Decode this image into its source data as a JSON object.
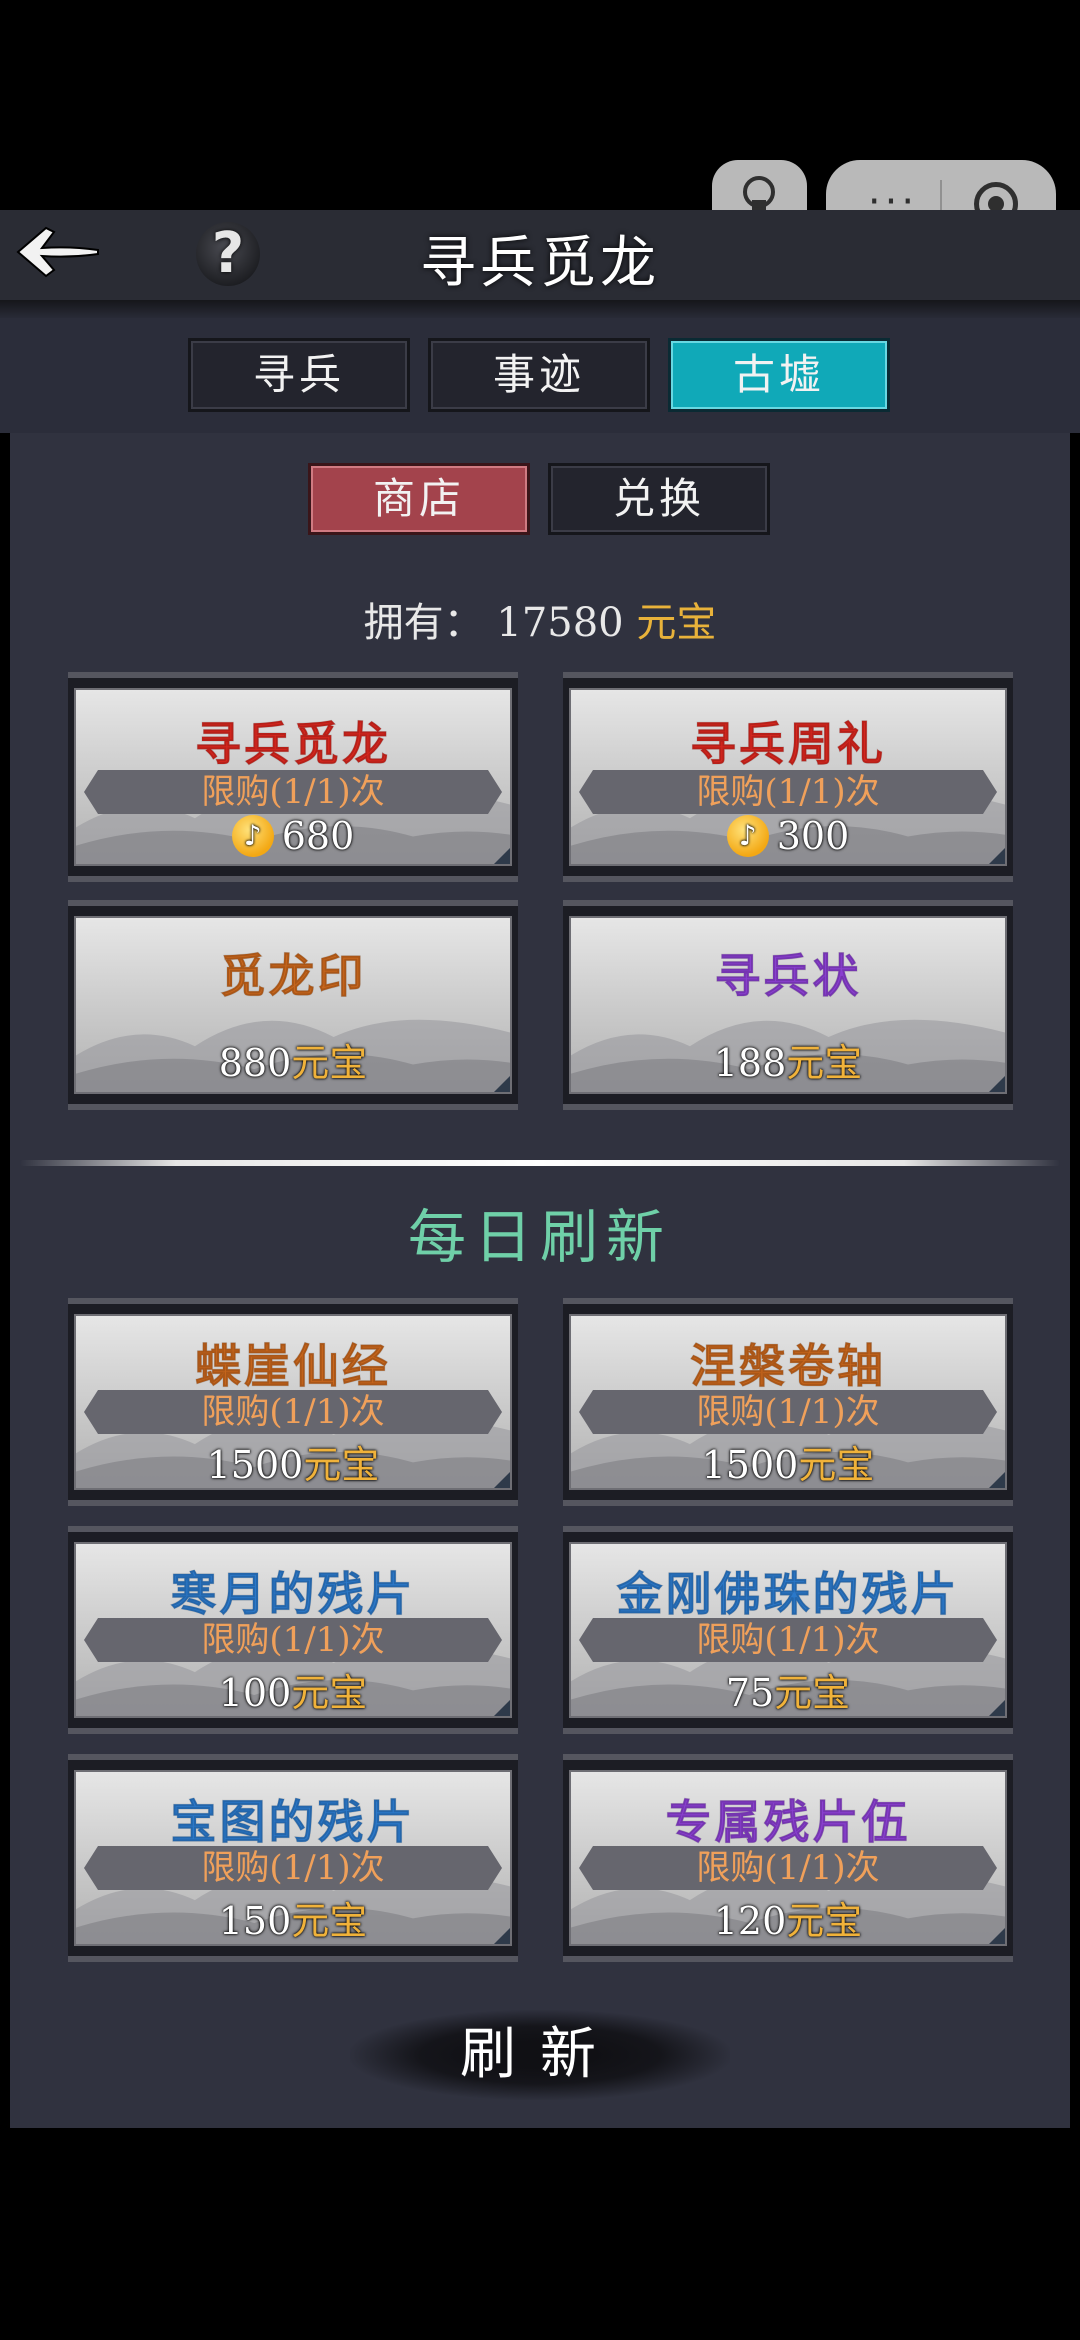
{
  "header": {
    "title": "寻兵觅龙",
    "back_icon": "back-arrow-icon",
    "help_label": "?"
  },
  "capsule": {
    "more_label": "···"
  },
  "tabs": [
    {
      "label": "寻兵"
    },
    {
      "label": "事迹"
    },
    {
      "label": "古墟",
      "active": true
    }
  ],
  "subtabs": [
    {
      "label": "商店",
      "active": true
    },
    {
      "label": "兑换"
    }
  ],
  "balance": {
    "prefix": "拥有：",
    "amount": "17580",
    "currency": "元宝"
  },
  "shop_items": [
    {
      "name": "寻兵觅龙",
      "name_color": "#d8261e",
      "limit": "限购(1/1)次",
      "price": "680",
      "price_unit": "",
      "icon": "diamond-coin-icon"
    },
    {
      "name": "寻兵周礼",
      "name_color": "#d8261e",
      "limit": "限购(1/1)次",
      "price": "300",
      "price_unit": "",
      "icon": "diamond-coin-icon"
    },
    {
      "name": "觅龙印",
      "name_color": "#c8661c",
      "limit": "",
      "price": "880",
      "price_unit": "元宝"
    },
    {
      "name": "寻兵状",
      "name_color": "#8a3fd0",
      "limit": "",
      "price": "188",
      "price_unit": "元宝"
    }
  ],
  "daily": {
    "title": "每日刷新",
    "items": [
      {
        "name": "蝶崖仙经",
        "name_color": "#c8661c",
        "limit": "限购(1/1)次",
        "price": "1500",
        "price_unit": "元宝"
      },
      {
        "name": "涅槃卷轴",
        "name_color": "#c8661c",
        "limit": "限购(1/1)次",
        "price": "1500",
        "price_unit": "元宝"
      },
      {
        "name": "寒月的残片",
        "name_color": "#2b78c9",
        "limit": "限购(1/1)次",
        "price": "100",
        "price_unit": "元宝"
      },
      {
        "name": "金刚佛珠的残片",
        "name_color": "#2b78c9",
        "limit": "限购(1/1)次",
        "price": "75",
        "price_unit": "元宝"
      },
      {
        "name": "宝图的残片",
        "name_color": "#2b78c9",
        "limit": "限购(1/1)次",
        "price": "150",
        "price_unit": "元宝"
      },
      {
        "name": "专属残片伍",
        "name_color": "#8a3fd0",
        "limit": "限购(1/1)次",
        "price": "120",
        "price_unit": "元宝"
      }
    ]
  },
  "refresh_label": "刷新"
}
